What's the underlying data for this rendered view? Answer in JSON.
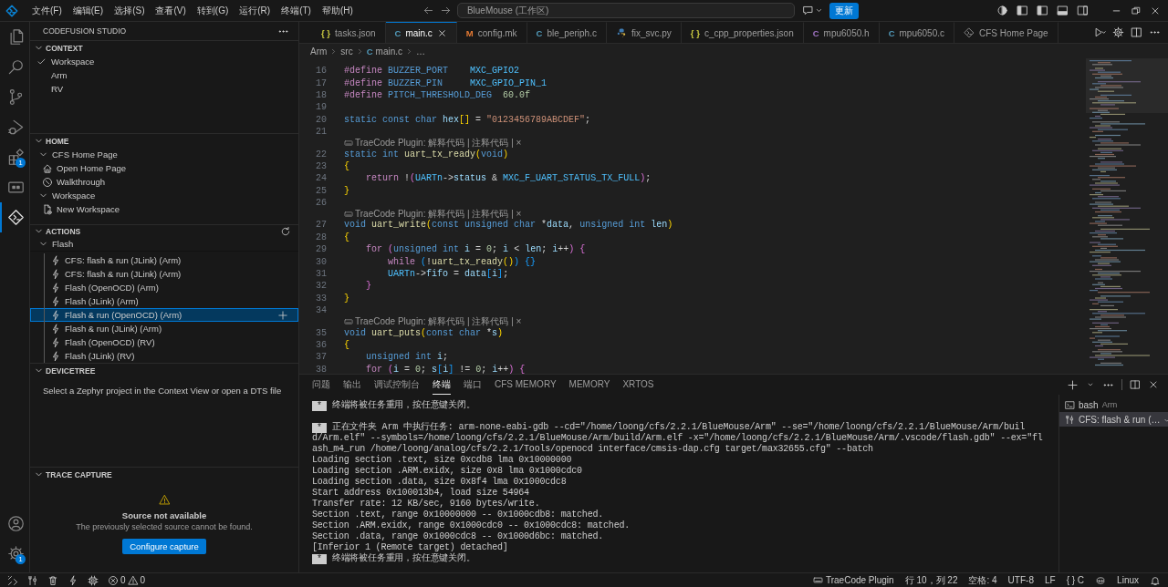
{
  "title_bar": {
    "menus": [
      "文件(F)",
      "编辑(E)",
      "选择(S)",
      "查看(V)",
      "转到(G)",
      "运行(R)",
      "终端(T)",
      "帮助(H)"
    ],
    "search": "BlueMouse (工作区)",
    "update_button": "更新"
  },
  "activity_bar": {
    "items": [
      {
        "kind": "files",
        "selected": false
      },
      {
        "kind": "search",
        "selected": false
      },
      {
        "kind": "scm",
        "selected": false
      },
      {
        "kind": "debug",
        "selected": false
      },
      {
        "kind": "extensions",
        "selected": false,
        "badge": "1"
      },
      {
        "kind": "remote",
        "selected": false
      },
      {
        "kind": "cfs",
        "selected": true
      }
    ],
    "bottom": [
      {
        "kind": "account"
      },
      {
        "kind": "settings",
        "badge": "1"
      }
    ]
  },
  "sidebar": {
    "title": "CODEFUSION STUDIO",
    "sections": [
      {
        "kind": "context",
        "title": "CONTEXT",
        "expanded": true,
        "items": [
          {
            "label": "Workspace",
            "checked": true
          },
          {
            "label": "Arm",
            "checked": false
          },
          {
            "label": "RV",
            "checked": false
          }
        ]
      },
      {
        "kind": "home",
        "title": "HOME",
        "expanded": true,
        "items": [
          {
            "label": "CFS Home Page",
            "expanded": true,
            "children": [
              {
                "label": "Open Home Page",
                "kind": "home"
              },
              {
                "label": "Walkthrough",
                "kind": "walkthrough"
              }
            ]
          },
          {
            "label": "Workspace",
            "expanded": true,
            "children": [
              {
                "label": "New Workspace",
                "kind": "new"
              }
            ]
          }
        ]
      },
      {
        "kind": "actions",
        "title": "ACTIONS",
        "expanded": true,
        "items": [
          {
            "label": "Flash",
            "expanded": true,
            "children": [
              {
                "label": "CFS: flash & run (JLink) (Arm)",
                "selected": false
              },
              {
                "label": "CFS: flash & run (JLink) (Arm)",
                "selected": false
              },
              {
                "label": "Flash (OpenOCD) (Arm)",
                "selected": false
              },
              {
                "label": "Flash (JLink) (Arm)",
                "selected": false
              },
              {
                "label": "Flash & run (OpenOCD) (Arm)",
                "selected": true
              },
              {
                "label": "Flash & run (JLink) (Arm)",
                "selected": false
              },
              {
                "label": "Flash (OpenOCD) (RV)",
                "selected": false
              },
              {
                "label": "Flash (JLink) (RV)",
                "selected": false
              }
            ]
          }
        ]
      },
      {
        "kind": "devicetree",
        "title": "DEVICETREE",
        "expanded": true,
        "message": "Select a Zephyr project in the Context View or open a DTS file"
      },
      {
        "kind": "trace",
        "title": "TRACE CAPTURE",
        "expanded": true,
        "heading": "Source not available",
        "message": "The previously selected source cannot be found.",
        "button": "Configure capture"
      }
    ]
  },
  "editor": {
    "tabs": [
      {
        "label": "tasks.json",
        "kind": "json",
        "glyph": "{ }",
        "selected": false
      },
      {
        "label": "main.c",
        "kind": "c",
        "glyph": "C",
        "selected": true
      },
      {
        "label": "config.mk",
        "kind": "mk",
        "glyph": "M",
        "selected": false
      },
      {
        "label": "ble_periph.c",
        "kind": "c",
        "glyph": "C",
        "selected": false
      },
      {
        "label": "fix_svc.py",
        "kind": "py",
        "selected": false
      },
      {
        "label": "c_cpp_properties.json",
        "kind": "json",
        "glyph": "{ }",
        "selected": false
      },
      {
        "label": "mpu6050.h",
        "kind": "h",
        "glyph": "C",
        "selected": false
      },
      {
        "label": "mpu6050.c",
        "kind": "c",
        "glyph": "C",
        "selected": false
      },
      {
        "label": "CFS Home Page",
        "kind": "home",
        "selected": false
      }
    ],
    "breadcrumb": [
      {
        "kind": "folder",
        "text": "Arm"
      },
      {
        "kind": "folder",
        "text": "src"
      },
      {
        "kind": "file",
        "glyph": "C",
        "text": "main.c"
      },
      {
        "kind": "more",
        "text": "…"
      }
    ],
    "lines": [
      {
        "kind": "code",
        "number": "16",
        "tokens": [
          {
            "kind": "kw",
            "text": "#define "
          },
          {
            "kind": "type",
            "text": "BUZZER_PORT    "
          },
          {
            "kind": "mac",
            "text": "MXC_GPIO2"
          }
        ]
      },
      {
        "kind": "code",
        "number": "17",
        "tokens": [
          {
            "kind": "kw",
            "text": "#define "
          },
          {
            "kind": "type",
            "text": "BUZZER_PIN     "
          },
          {
            "kind": "mac",
            "text": "MXC_GPIO_PIN_1"
          }
        ]
      },
      {
        "kind": "code",
        "number": "18",
        "tokens": [
          {
            "kind": "kw",
            "text": "#define "
          },
          {
            "kind": "type",
            "text": "PITCH_THRESHOLD_DEG  "
          },
          {
            "kind": "num",
            "text": "60.0f"
          }
        ]
      },
      {
        "kind": "code",
        "number": "19"
      },
      {
        "kind": "code",
        "number": "20",
        "tokens": [
          {
            "kind": "type",
            "text": "static const char "
          },
          {
            "kind": "var",
            "text": "hex"
          },
          {
            "kind": "b1",
            "text": "[]"
          },
          {
            "kind": "op",
            "text": " = "
          },
          {
            "kind": "str",
            "text": "\"0123456789ABCDEF\""
          },
          {
            "kind": "op",
            "text": ";"
          }
        ]
      },
      {
        "kind": "code",
        "number": "21"
      },
      {
        "kind": "lens",
        "text": "TraeCode Plugin: 解释代码 | 注释代码 | ×"
      },
      {
        "kind": "code",
        "number": "22",
        "tokens": [
          {
            "kind": "type",
            "text": "static int "
          },
          {
            "kind": "fn",
            "text": "uart_tx_ready"
          },
          {
            "kind": "b1",
            "text": "("
          },
          {
            "kind": "type",
            "text": "void"
          },
          {
            "kind": "b1",
            "text": ")"
          }
        ]
      },
      {
        "kind": "code",
        "number": "23",
        "tokens": [
          {
            "kind": "b1",
            "text": "{"
          }
        ]
      },
      {
        "kind": "code",
        "number": "24",
        "tokens": [
          {
            "kind": "kw",
            "text": "    return"
          },
          {
            "kind": "op",
            "text": " !"
          },
          {
            "kind": "b2",
            "text": "("
          },
          {
            "kind": "mac",
            "text": "UARTn"
          },
          {
            "kind": "op",
            "text": "->"
          },
          {
            "kind": "var",
            "text": "status"
          },
          {
            "kind": "op",
            "text": " & "
          },
          {
            "kind": "mac",
            "text": "MXC_F_UART_STATUS_TX_FULL"
          },
          {
            "kind": "b2",
            "text": ")"
          },
          {
            "kind": "op",
            "text": ";"
          }
        ]
      },
      {
        "kind": "code",
        "number": "25",
        "tokens": [
          {
            "kind": "b1",
            "text": "}"
          }
        ]
      },
      {
        "kind": "code",
        "number": "26"
      },
      {
        "kind": "lens",
        "text": "TraeCode Plugin: 解释代码 | 注释代码 | ×"
      },
      {
        "kind": "code",
        "number": "27",
        "tokens": [
          {
            "kind": "type",
            "text": "void "
          },
          {
            "kind": "fn",
            "text": "uart_write"
          },
          {
            "kind": "b1",
            "text": "("
          },
          {
            "kind": "type",
            "text": "const unsigned char"
          },
          {
            "kind": "op",
            "text": " *"
          },
          {
            "kind": "var",
            "text": "data"
          },
          {
            "kind": "op",
            "text": ", "
          },
          {
            "kind": "type",
            "text": "unsigned int "
          },
          {
            "kind": "var",
            "text": "len"
          },
          {
            "kind": "b1",
            "text": ")"
          }
        ]
      },
      {
        "kind": "code",
        "number": "28",
        "tokens": [
          {
            "kind": "b1",
            "text": "{"
          }
        ]
      },
      {
        "kind": "code",
        "number": "29",
        "tokens": [
          {
            "kind": "kw",
            "text": "    for "
          },
          {
            "kind": "b2",
            "text": "("
          },
          {
            "kind": "type",
            "text": "unsigned int "
          },
          {
            "kind": "var",
            "text": "i"
          },
          {
            "kind": "op",
            "text": " = "
          },
          {
            "kind": "num",
            "text": "0"
          },
          {
            "kind": "op",
            "text": "; "
          },
          {
            "kind": "var",
            "text": "i"
          },
          {
            "kind": "op",
            "text": " < "
          },
          {
            "kind": "var",
            "text": "len"
          },
          {
            "kind": "op",
            "text": "; "
          },
          {
            "kind": "var",
            "text": "i"
          },
          {
            "kind": "op",
            "text": "++"
          },
          {
            "kind": "b2",
            "text": ")"
          },
          {
            "kind": "b2",
            "text": " {"
          }
        ]
      },
      {
        "kind": "code",
        "number": "30",
        "tokens": [
          {
            "kind": "kw",
            "text": "        while "
          },
          {
            "kind": "b3",
            "text": "("
          },
          {
            "kind": "op",
            "text": "!"
          },
          {
            "kind": "fn",
            "text": "uart_tx_ready"
          },
          {
            "kind": "b1",
            "text": "()"
          },
          {
            "kind": "b3",
            "text": ")"
          },
          {
            "kind": "b3",
            "text": " {}"
          }
        ]
      },
      {
        "kind": "code",
        "number": "31",
        "tokens": [
          {
            "kind": "mac",
            "text": "        UARTn"
          },
          {
            "kind": "op",
            "text": "->"
          },
          {
            "kind": "var",
            "text": "fifo"
          },
          {
            "kind": "op",
            "text": " = "
          },
          {
            "kind": "var",
            "text": "data"
          },
          {
            "kind": "b3",
            "text": "["
          },
          {
            "kind": "var",
            "text": "i"
          },
          {
            "kind": "b3",
            "text": "]"
          },
          {
            "kind": "op",
            "text": ";"
          }
        ]
      },
      {
        "kind": "code",
        "number": "32",
        "tokens": [
          {
            "kind": "b2",
            "text": "    }"
          }
        ]
      },
      {
        "kind": "code",
        "number": "33",
        "tokens": [
          {
            "kind": "b1",
            "text": "}"
          }
        ]
      },
      {
        "kind": "code",
        "number": "34"
      },
      {
        "kind": "lens",
        "text": "TraeCode Plugin: 解释代码 | 注释代码 | ×"
      },
      {
        "kind": "code",
        "number": "35",
        "tokens": [
          {
            "kind": "type",
            "text": "void "
          },
          {
            "kind": "fn",
            "text": "uart_puts"
          },
          {
            "kind": "b1",
            "text": "("
          },
          {
            "kind": "type",
            "text": "const char"
          },
          {
            "kind": "op",
            "text": " *"
          },
          {
            "kind": "var",
            "text": "s"
          },
          {
            "kind": "b1",
            "text": ")"
          }
        ]
      },
      {
        "kind": "code",
        "number": "36",
        "tokens": [
          {
            "kind": "b1",
            "text": "{"
          }
        ]
      },
      {
        "kind": "code",
        "number": "37",
        "tokens": [
          {
            "kind": "type",
            "text": "    unsigned int "
          },
          {
            "kind": "var",
            "text": "i"
          },
          {
            "kind": "op",
            "text": ";"
          }
        ]
      },
      {
        "kind": "code",
        "number": "38",
        "tokens": [
          {
            "kind": "kw",
            "text": "    for "
          },
          {
            "kind": "b2",
            "text": "("
          },
          {
            "kind": "var",
            "text": "i"
          },
          {
            "kind": "op",
            "text": " = "
          },
          {
            "kind": "num",
            "text": "0"
          },
          {
            "kind": "op",
            "text": "; "
          },
          {
            "kind": "var",
            "text": "s"
          },
          {
            "kind": "b3",
            "text": "["
          },
          {
            "kind": "var",
            "text": "i"
          },
          {
            "kind": "b3",
            "text": "]"
          },
          {
            "kind": "op",
            "text": " != "
          },
          {
            "kind": "num",
            "text": "0"
          },
          {
            "kind": "op",
            "text": "; "
          },
          {
            "kind": "var",
            "text": "i"
          },
          {
            "kind": "op",
            "text": "++"
          },
          {
            "kind": "b2",
            "text": ")"
          },
          {
            "kind": "b2",
            "text": " {"
          }
        ]
      }
    ]
  },
  "panel": {
    "tabs": [
      {
        "label": "问题",
        "selected": false
      },
      {
        "label": "输出",
        "selected": false
      },
      {
        "label": "调试控制台",
        "selected": false
      },
      {
        "label": "终端",
        "selected": true
      },
      {
        "label": "端口",
        "selected": false
      },
      {
        "label": "CFS MEMORY",
        "selected": false
      },
      {
        "label": "MEMORY",
        "selected": false
      },
      {
        "label": "XRTOS",
        "selected": false
      }
    ],
    "terminal": [
      {
        "kind": "notice",
        "marker": "*",
        "text": "终端将被任务重用，按任意键关闭。"
      },
      {
        "kind": "blank"
      },
      {
        "kind": "notice",
        "marker": "*",
        "text": "正在文件夹 Arm 中执行任务: arm-none-eabi-gdb --cd=\"/home/loong/cfs/2.2.1/BlueMouse/Arm\" --se=\"/home/loong/cfs/2.2.1/BlueMouse/Arm/buil"
      },
      {
        "kind": "output",
        "text": "d/Arm.elf\" --symbols=/home/loong/cfs/2.2.1/BlueMouse/Arm/build/Arm.elf -x=\"/home/loong/cfs/2.2.1/BlueMouse/Arm/.vscode/flash.gdb\" --ex=\"fl"
      },
      {
        "kind": "output",
        "text": "ash_m4_run /home/loong/analog/cfs/2.2.1/Tools/openocd interface/cmsis-dap.cfg target/max32655.cfg\" --batch"
      },
      {
        "kind": "output",
        "text": "Loading section .text, size 0xcdb8 lma 0x10000000"
      },
      {
        "kind": "output",
        "text": "Loading section .ARM.exidx, size 0x8 lma 0x1000cdc0"
      },
      {
        "kind": "output",
        "text": "Loading section .data, size 0x8f4 lma 0x1000cdc8"
      },
      {
        "kind": "output",
        "text": "Start address 0x100013b4, load size 54964"
      },
      {
        "kind": "output",
        "text": "Transfer rate: 12 KB/sec, 9160 bytes/write."
      },
      {
        "kind": "output",
        "text": "Section .text, range 0x10000000 -- 0x1000cdb8: matched."
      },
      {
        "kind": "output",
        "text": "Section .ARM.exidx, range 0x1000cdc0 -- 0x1000cdc8: matched."
      },
      {
        "kind": "output",
        "text": "Section .data, range 0x1000cdc8 -- 0x1000d6bc: matched."
      },
      {
        "kind": "output",
        "text": "[Inferior 1 (Remote target) detached]"
      },
      {
        "kind": "notice",
        "marker": "*",
        "text": "终端将被任务重用，按任意键关闭。"
      }
    ],
    "sessions": [
      {
        "kind": "shell",
        "name": "bash",
        "detail": "Arm",
        "selected": false
      },
      {
        "kind": "task",
        "name": "CFS: flash & run (…",
        "selected": true
      }
    ]
  },
  "status_bar": {
    "left": [
      {
        "kind": "remote"
      },
      {
        "kind": "tools"
      },
      {
        "kind": "trash"
      },
      {
        "kind": "flash"
      },
      {
        "kind": "chip"
      }
    ],
    "errors": "0",
    "warnings": "0",
    "right": [
      {
        "kind": "plugin",
        "text": "TraeCode Plugin"
      },
      {
        "kind": "text",
        "text": "行 10，列 22"
      },
      {
        "kind": "text",
        "text": "空格: 4"
      },
      {
        "kind": "text",
        "text": "UTF-8"
      },
      {
        "kind": "text",
        "text": "LF"
      },
      {
        "kind": "text",
        "text": "{ } C"
      },
      {
        "kind": "copilot"
      },
      {
        "kind": "text",
        "text": "Linux"
      },
      {
        "kind": "bell"
      }
    ]
  }
}
